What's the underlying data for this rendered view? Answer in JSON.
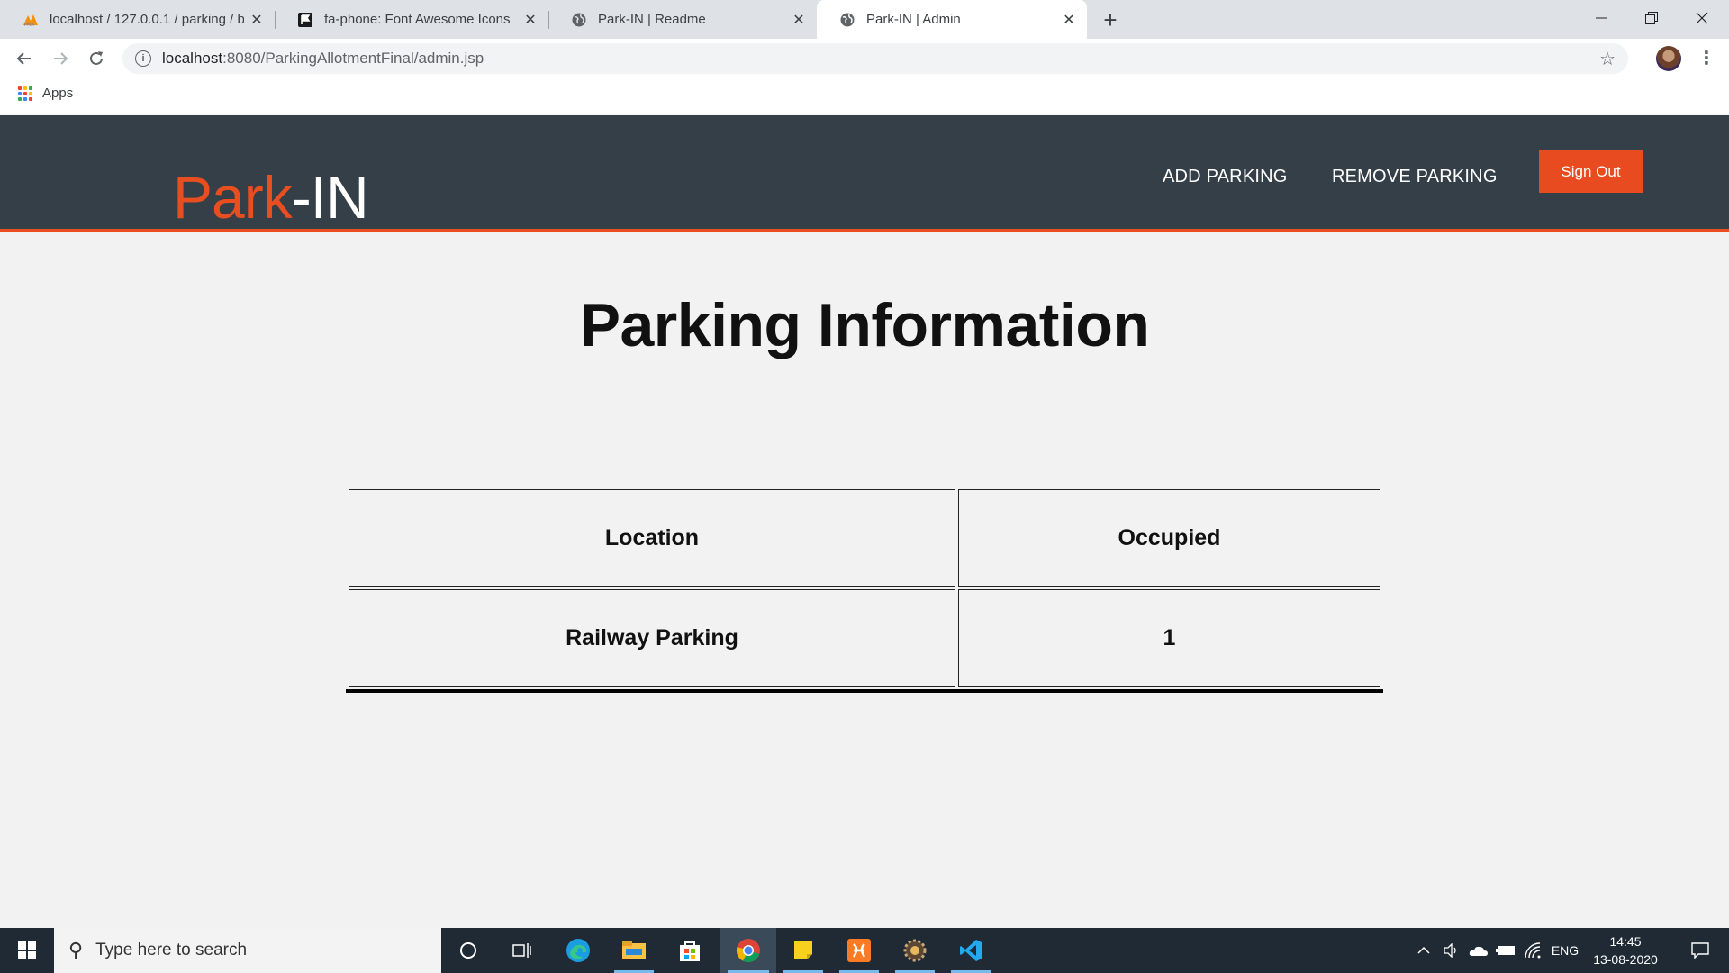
{
  "browser": {
    "tabs": [
      {
        "title": "localhost / 127.0.0.1 / parking / b",
        "active": false
      },
      {
        "title": "fa-phone: Font Awesome Icons",
        "active": false
      },
      {
        "title": "Park-IN | Readme",
        "active": false
      },
      {
        "title": "Park-IN | Admin",
        "active": true
      }
    ],
    "url_host": "localhost",
    "url_path": ":8080/ParkingAllotmentFinal/admin.jsp",
    "bookmarks": {
      "apps_label": "Apps"
    }
  },
  "site": {
    "logo_part1": "Park",
    "logo_part2": "-IN",
    "nav": {
      "add_parking": "ADD PARKING",
      "remove_parking": "REMOVE PARKING"
    },
    "sign_out": "Sign Out",
    "accent": "#e94e20",
    "header_bg": "#343f48"
  },
  "main": {
    "title": "Parking Information",
    "table": {
      "headers": [
        "Location",
        "Occupied"
      ],
      "rows": [
        [
          "Railway Parking",
          "1"
        ]
      ]
    }
  },
  "taskbar": {
    "search_placeholder": "Type here to search",
    "language": "ENG",
    "time": "14:45",
    "date": "13-08-2020"
  }
}
